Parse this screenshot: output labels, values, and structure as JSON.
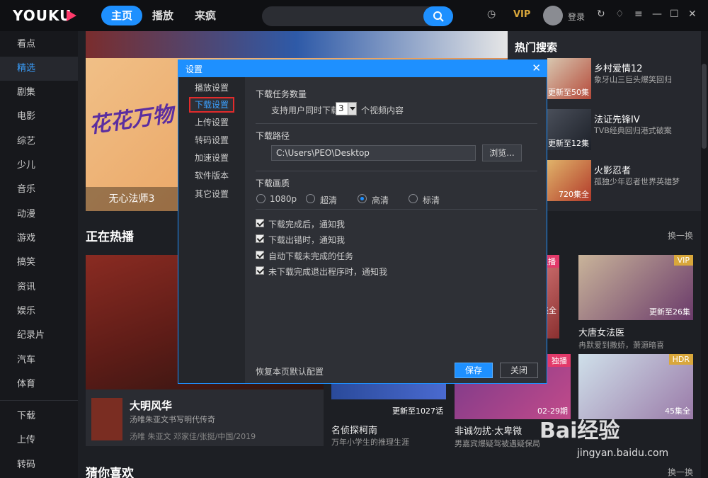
{
  "app": {
    "logo": "YOUKU",
    "nav_tabs": [
      "主页",
      "播放",
      "来疯"
    ],
    "vip": "VIP",
    "login": "登录",
    "colors": {
      "accent": "#1e90ff",
      "vip": "#d9a73b",
      "logo_mark": "#ff3a6b",
      "highlight_box": "#e22b2b"
    }
  },
  "sidebar": {
    "items": [
      "看点",
      "精选",
      "剧集",
      "电影",
      "综艺",
      "少儿",
      "音乐",
      "动漫",
      "游戏",
      "搞笑",
      "资讯",
      "娱乐",
      "纪录片",
      "汽车",
      "体育"
    ],
    "active": "精选",
    "bottom_items": [
      "下载",
      "上传",
      "转码"
    ]
  },
  "banner": {
    "logo_text": "花花万物",
    "caption": "无心法师3"
  },
  "hot_search": {
    "title": "热门搜索",
    "items": [
      {
        "name": "乡村爱情12",
        "desc": "象牙山三巨头爆笑回归",
        "ep": "更新至50集"
      },
      {
        "name": "法证先锋IV",
        "desc": "TVB经典回归港式破案",
        "ep": "更新至12集"
      },
      {
        "name": "火影忍者",
        "desc": "孤独少年忍者世界英雄梦",
        "ep": "720集全"
      }
    ]
  },
  "now_playing": {
    "title": "正在热播",
    "refresh": "换一换",
    "big": {
      "name": "大明风华",
      "desc": "汤唯朱亚文书写明代传奇",
      "cast": "汤唯 朱亚文 邓家佳/张挺/中国/2019"
    },
    "cards": [
      {
        "badge": "独播",
        "ep": "集全",
        "name": "",
        "desc": ""
      },
      {
        "badge": "VIP",
        "ep": "更新至26集",
        "name": "大唐女法医",
        "desc": "冉默爱到撒娇，萧源暗喜"
      },
      {
        "badge": "",
        "ep": "更新至1027话",
        "name": "名侦探柯南",
        "desc": "万年小学生的推理生涯"
      },
      {
        "badge": "独播",
        "ep": "02-29期",
        "name": "非诚勿扰·太卑微",
        "desc": "男嘉宾爆疑驾被遇疑保局"
      },
      {
        "badge": "HDR",
        "ep": "45集全",
        "name": "",
        "desc": ""
      }
    ]
  },
  "guess": {
    "title": "猜你喜欢",
    "refresh": "换一换"
  },
  "dialog": {
    "title": "设置",
    "nav": [
      "播放设置",
      "下载设置",
      "上传设置",
      "转码设置",
      "加速设置",
      "软件版本",
      "其它设置"
    ],
    "active_nav": "下载设置",
    "task_section": "下载任务数量",
    "task_prefix": "支持用户同时下载",
    "task_value": "3",
    "task_suffix": "个视频内容",
    "path_section": "下载路径",
    "path_value": "C:\\Users\\PEO\\Desktop",
    "browse": "浏览...",
    "quality_section": "下载画质",
    "quality_options": [
      "1080p",
      "超清",
      "高清",
      "标清"
    ],
    "quality_selected": "高清",
    "checkboxes": [
      "下载完成后，通知我",
      "下载出错时，通知我",
      "自动下载未完成的任务",
      "未下载完成退出程序时，通知我"
    ],
    "restore": "恢复本页默认配置",
    "save": "保存",
    "close": "关闭"
  },
  "watermark": {
    "text": "Bai经验",
    "sub": "jingyan.baidu.com"
  }
}
